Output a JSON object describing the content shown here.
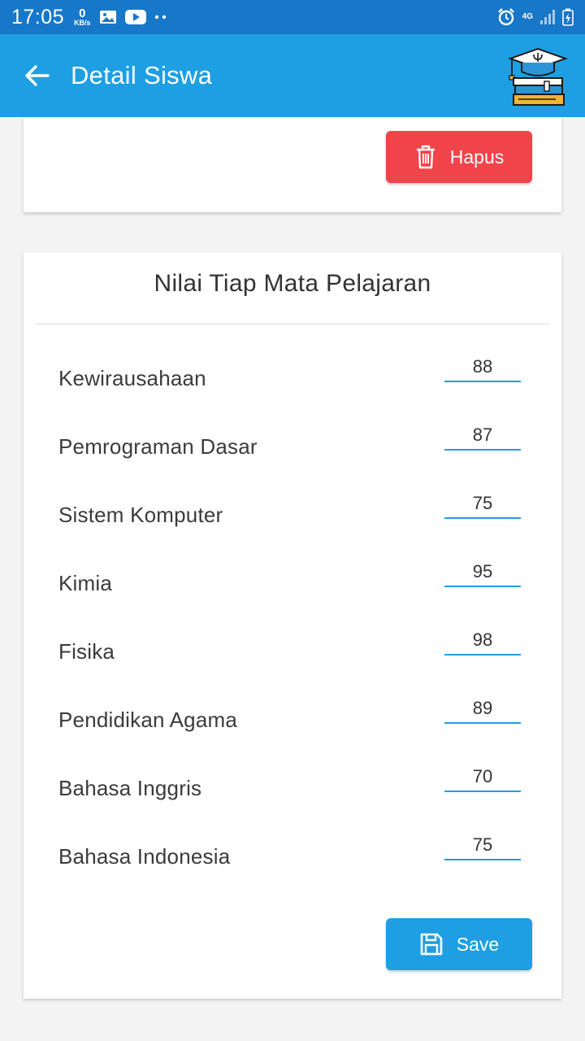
{
  "status_bar": {
    "time": "17:05",
    "speed_value": "0",
    "speed_unit": "KB/s",
    "network": "4G"
  },
  "app_bar": {
    "title": "Detail Siswa"
  },
  "actions": {
    "delete_label": "Hapus",
    "save_label": "Save"
  },
  "grades": {
    "title": "Nilai Tiap Mata Pelajaran",
    "subjects": [
      {
        "name": "Kewirausahaan",
        "value": "88"
      },
      {
        "name": "Pemrograman Dasar",
        "value": "87"
      },
      {
        "name": "Sistem Komputer",
        "value": "75"
      },
      {
        "name": "Kimia",
        "value": "95"
      },
      {
        "name": "Fisika",
        "value": "98"
      },
      {
        "name": "Pendidikan Agama",
        "value": "89"
      },
      {
        "name": "Bahasa Inggris",
        "value": "70"
      },
      {
        "name": "Bahasa Indonesia",
        "value": "75"
      }
    ]
  },
  "colors": {
    "status_bar": "#1777c8",
    "app_bar": "#1e9fe3",
    "delete": "#f0444b",
    "save": "#1e9fe3"
  }
}
